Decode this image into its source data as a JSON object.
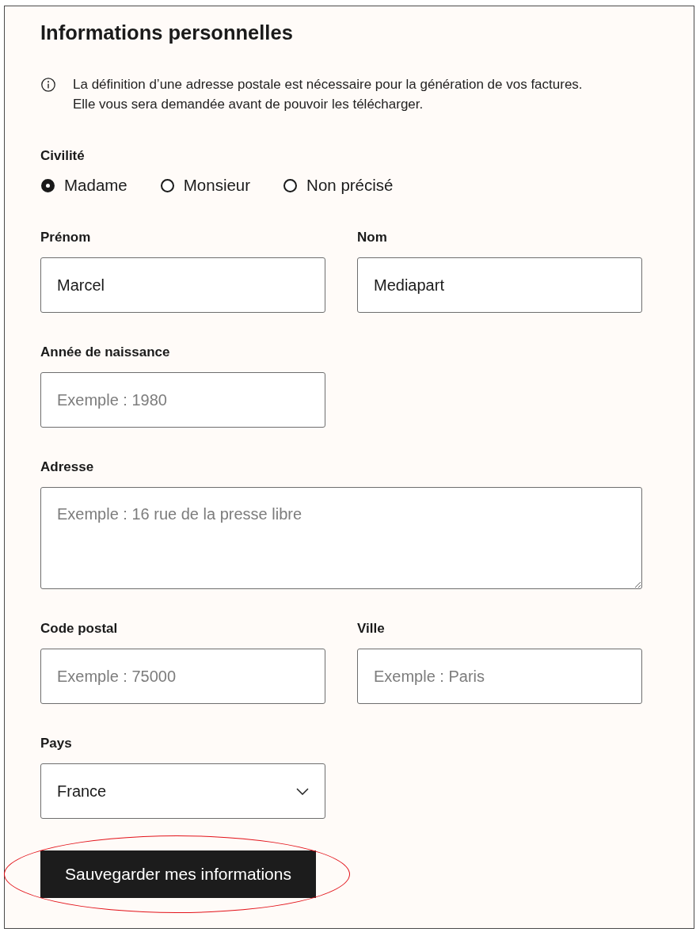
{
  "title": "Informations personnelles",
  "notice": {
    "lines": [
      "La définition d’une adresse postale est nécessaire pour la génération de vos factures.",
      "Elle vous sera demandée avant de pouvoir les télécharger."
    ]
  },
  "civility": {
    "label": "Civilité",
    "options": [
      {
        "label": "Madame",
        "selected": true
      },
      {
        "label": "Monsieur",
        "selected": false
      },
      {
        "label": "Non précisé",
        "selected": false
      }
    ]
  },
  "form_rows": [
    [
      {
        "kind": "text",
        "label": "Prénom",
        "value": "Marcel"
      },
      {
        "kind": "text",
        "label": "Nom",
        "value": "Mediapart"
      }
    ],
    [
      {
        "kind": "text",
        "label": "Année de naissance",
        "placeholder": "Exemple : 1980"
      }
    ],
    [
      {
        "kind": "textarea",
        "label": "Adresse",
        "placeholder": "Exemple : 16 rue de la presse libre"
      }
    ],
    [
      {
        "kind": "text",
        "label": "Code postal",
        "placeholder": "Exemple : 75000"
      },
      {
        "kind": "text",
        "label": "Ville",
        "placeholder": "Exemple : Paris"
      }
    ],
    [
      {
        "kind": "select",
        "label": "Pays",
        "value": "France"
      }
    ]
  ],
  "save_button": {
    "label": "Sauvegarder mes informations",
    "highlighted": true
  }
}
